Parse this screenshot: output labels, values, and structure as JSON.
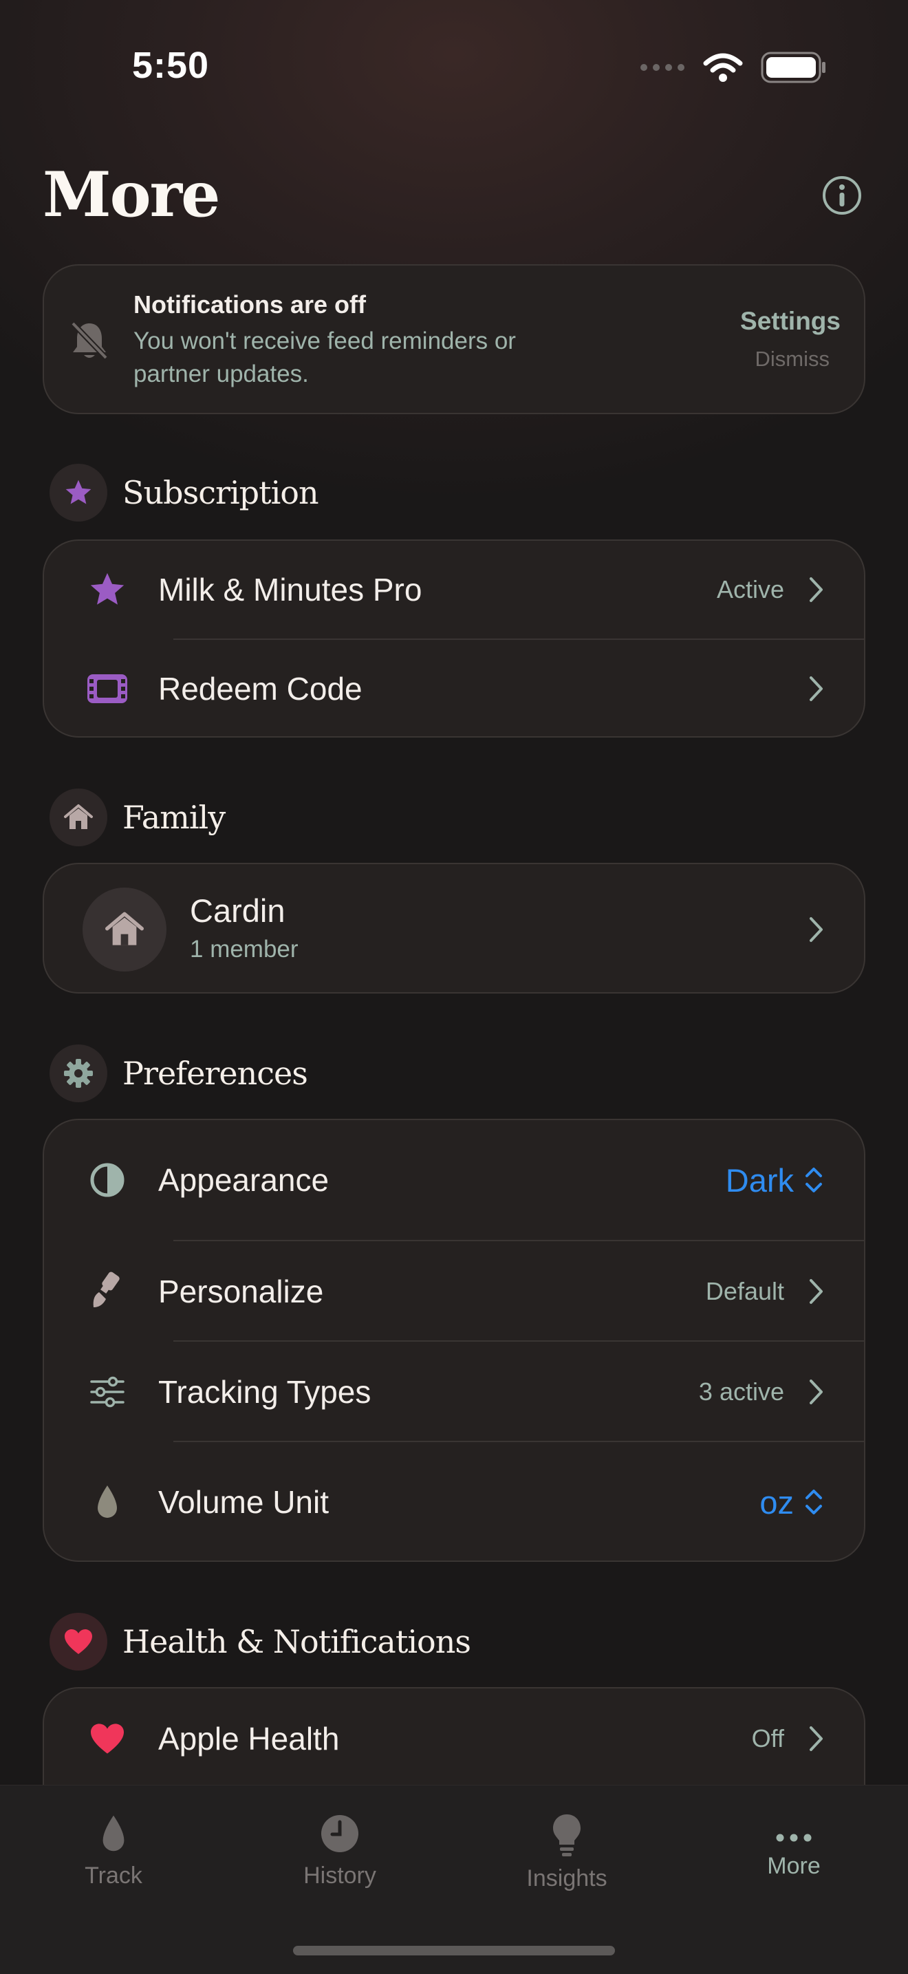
{
  "status_bar": {
    "time": "5:50"
  },
  "page": {
    "title": "More"
  },
  "notification_banner": {
    "title": "Notifications are off",
    "body_line1": "You won't receive feed reminders or",
    "body_line2": "partner updates.",
    "settings_label": "Settings",
    "dismiss_label": "Dismiss"
  },
  "subscription": {
    "title": "Subscription",
    "items": [
      {
        "label": "Milk & Minutes Pro",
        "value": "Active",
        "icon": "star-icon"
      },
      {
        "label": "Redeem Code",
        "value": "",
        "icon": "ticket-icon"
      }
    ]
  },
  "family": {
    "title": "Family",
    "name": "Cardin",
    "members": "1 member"
  },
  "preferences": {
    "title": "Preferences",
    "items": [
      {
        "label": "Appearance",
        "value": "Dark",
        "icon": "contrast-icon"
      },
      {
        "label": "Personalize",
        "value": "Default",
        "icon": "paintbrush-icon"
      },
      {
        "label": "Tracking Types",
        "value": "3 active",
        "icon": "sliders-icon"
      },
      {
        "label": "Volume Unit",
        "value": "oz",
        "icon": "drop-icon"
      }
    ]
  },
  "health": {
    "title": "Health & Notifications",
    "items": [
      {
        "label": "Apple Health",
        "value": "Off",
        "icon": "heart-icon"
      }
    ]
  },
  "tabs": [
    {
      "label": "Track",
      "icon": "drop-icon"
    },
    {
      "label": "History",
      "icon": "clock-icon"
    },
    {
      "label": "Insights",
      "icon": "lightbulb-icon"
    },
    {
      "label": "More",
      "icon": "ellipsis-icon"
    }
  ],
  "colors": {
    "accent_blue": "#2f8cf0",
    "accent_purple": "#9b5cc4",
    "heart_red": "#f0365a",
    "muted_teal": "#9fb4ab"
  }
}
